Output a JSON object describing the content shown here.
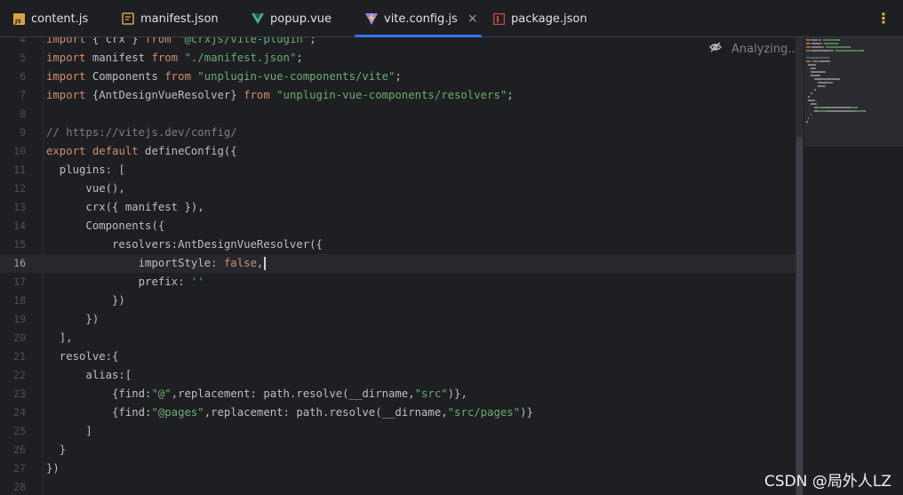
{
  "tabs": [
    {
      "name": "tab-content-js",
      "label": "content.js",
      "icon": "js-file-icon",
      "active": false
    },
    {
      "name": "tab-manifest-json",
      "label": "manifest.json",
      "icon": "json-file-icon",
      "active": false
    },
    {
      "name": "tab-popup-vue",
      "label": "popup.vue",
      "icon": "vue-file-icon",
      "active": false
    },
    {
      "name": "tab-vite-config-js",
      "label": "vite.config.js",
      "icon": "vite-file-icon",
      "active": true
    },
    {
      "name": "tab-package-json",
      "label": "package.json",
      "icon": "npm-package-icon",
      "active": false
    }
  ],
  "active_tab_close": "×",
  "more_menu": "⋮",
  "status": {
    "analyzing": "Analyzing..."
  },
  "current_line": 16,
  "code_lines": [
    {
      "n": "4",
      "tokens": [
        {
          "t": "import",
          "c": "kw"
        },
        {
          "t": " { crx } ",
          "c": ""
        },
        {
          "t": "from",
          "c": "kw"
        },
        {
          "t": " ",
          "c": ""
        },
        {
          "t": "\"@crxjs/vite-plugin\"",
          "c": "str"
        },
        {
          "t": ";",
          "c": ""
        }
      ]
    },
    {
      "n": "5",
      "tokens": [
        {
          "t": "import",
          "c": "kw"
        },
        {
          "t": " manifest ",
          "c": ""
        },
        {
          "t": "from",
          "c": "kw"
        },
        {
          "t": " ",
          "c": ""
        },
        {
          "t": "\"./manifest.json\"",
          "c": "str"
        },
        {
          "t": ";",
          "c": ""
        }
      ]
    },
    {
      "n": "6",
      "tokens": [
        {
          "t": "import",
          "c": "kw"
        },
        {
          "t": " Components ",
          "c": ""
        },
        {
          "t": "from",
          "c": "kw"
        },
        {
          "t": " ",
          "c": ""
        },
        {
          "t": "\"unplugin-vue-components/vite\"",
          "c": "str"
        },
        {
          "t": ";",
          "c": ""
        }
      ]
    },
    {
      "n": "7",
      "tokens": [
        {
          "t": "import",
          "c": "kw"
        },
        {
          "t": " {AntDesignVueResolver} ",
          "c": ""
        },
        {
          "t": "from",
          "c": "kw"
        },
        {
          "t": " ",
          "c": ""
        },
        {
          "t": "\"unplugin-vue-components/resolvers\"",
          "c": "str"
        },
        {
          "t": ";",
          "c": ""
        }
      ]
    },
    {
      "n": "8",
      "tokens": []
    },
    {
      "n": "9",
      "tokens": [
        {
          "t": "// https://vitejs.dev/config/",
          "c": "cmt"
        }
      ]
    },
    {
      "n": "10",
      "tokens": [
        {
          "t": "export",
          "c": "kw"
        },
        {
          "t": " ",
          "c": ""
        },
        {
          "t": "default",
          "c": "kw"
        },
        {
          "t": " defineConfig({",
          "c": ""
        }
      ]
    },
    {
      "n": "11",
      "tokens": [
        {
          "t": "  plugins: [",
          "c": ""
        }
      ]
    },
    {
      "n": "12",
      "tokens": [
        {
          "t": "      vue(),",
          "c": ""
        }
      ]
    },
    {
      "n": "13",
      "tokens": [
        {
          "t": "      crx({ manifest }),",
          "c": ""
        }
      ]
    },
    {
      "n": "14",
      "tokens": [
        {
          "t": "      Components({",
          "c": ""
        }
      ]
    },
    {
      "n": "15",
      "tokens": [
        {
          "t": "          resolvers:AntDesignVueResolver({",
          "c": ""
        }
      ]
    },
    {
      "n": "16",
      "tokens": [
        {
          "t": "              importStyle: ",
          "c": ""
        },
        {
          "t": "false",
          "c": "kw"
        },
        {
          "t": ",",
          "c": ""
        }
      ]
    },
    {
      "n": "17",
      "tokens": [
        {
          "t": "              prefix: ",
          "c": ""
        },
        {
          "t": "''",
          "c": "str"
        }
      ]
    },
    {
      "n": "18",
      "tokens": [
        {
          "t": "          })",
          "c": ""
        }
      ]
    },
    {
      "n": "19",
      "tokens": [
        {
          "t": "      })",
          "c": ""
        }
      ]
    },
    {
      "n": "20",
      "tokens": [
        {
          "t": "  ],",
          "c": ""
        }
      ]
    },
    {
      "n": "21",
      "tokens": [
        {
          "t": "  resolve:{",
          "c": ""
        }
      ]
    },
    {
      "n": "22",
      "tokens": [
        {
          "t": "      alias:[",
          "c": ""
        }
      ]
    },
    {
      "n": "23",
      "tokens": [
        {
          "t": "          {find:",
          "c": ""
        },
        {
          "t": "\"@\"",
          "c": "str"
        },
        {
          "t": ",replacement: path.resolve(__dirname,",
          "c": ""
        },
        {
          "t": "\"src\"",
          "c": "str"
        },
        {
          "t": ")},",
          "c": ""
        }
      ]
    },
    {
      "n": "24",
      "tokens": [
        {
          "t": "          {find:",
          "c": ""
        },
        {
          "t": "\"@pages\"",
          "c": "str"
        },
        {
          "t": ",replacement: path.resolve(__dirname,",
          "c": ""
        },
        {
          "t": "\"src/pages\"",
          "c": "str"
        },
        {
          "t": ")}",
          "c": ""
        }
      ]
    },
    {
      "n": "25",
      "tokens": [
        {
          "t": "      ]",
          "c": ""
        }
      ]
    },
    {
      "n": "26",
      "tokens": [
        {
          "t": "  }",
          "c": ""
        }
      ]
    },
    {
      "n": "27",
      "tokens": [
        {
          "t": "})",
          "c": ""
        }
      ]
    },
    {
      "n": "28",
      "tokens": []
    }
  ],
  "watermark": "CSDN @局外人LZ",
  "colors": {
    "background": "#1e1f22",
    "keyword": "#cf8e6d",
    "string": "#6aab73",
    "comment": "#7a7e85",
    "text": "#bcbec4",
    "tab_underline": "#3574f0"
  }
}
